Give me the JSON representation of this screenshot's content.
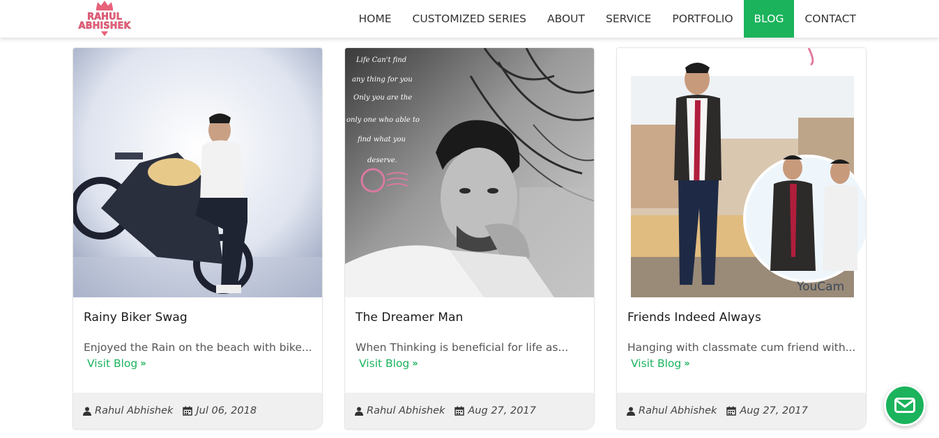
{
  "brand": {
    "logo_line1": "RAHUL",
    "logo_line2": "ABHISHEK",
    "accent_color": "#1bb35c",
    "logo_color": "#e8627a"
  },
  "nav": {
    "items": [
      {
        "label": "HOME",
        "active": false
      },
      {
        "label": "CUSTOMIZED SERIES",
        "active": false
      },
      {
        "label": "ABOUT",
        "active": false
      },
      {
        "label": "SERVICE",
        "active": false
      },
      {
        "label": "PORTFOLIO",
        "active": false
      },
      {
        "label": "BLOG",
        "active": true
      },
      {
        "label": "CONTACT",
        "active": false
      }
    ]
  },
  "posts": [
    {
      "title": "Rainy Biker Swag",
      "excerpt": "Enjoyed the Rain on the beach with bike...",
      "link_label": "Visit Blog",
      "author": "Rahul Abhishek",
      "date": "Jul 06, 2018"
    },
    {
      "title": "The Dreamer Man",
      "excerpt": "When Thinking is beneficial for life as...",
      "link_label": "Visit Blog",
      "author": "Rahul Abhishek",
      "date": "Aug 27, 2017",
      "image_text": [
        "Life Can't find",
        "any thing for you",
        "Only you are the",
        "only one who able to",
        "find what you",
        "deserve."
      ]
    },
    {
      "title": "Friends Indeed Always",
      "excerpt": "Hanging with classmate cum friend with...",
      "link_label": "Visit Blog",
      "author": "Rahul Abhishek",
      "date": "Aug 27, 2017",
      "image_text": [
        "YouCam"
      ]
    }
  ],
  "icons": {
    "author": "user-icon",
    "date": "calendar-icon",
    "link": "double-chevron-right-icon",
    "fab": "mail-icon"
  }
}
